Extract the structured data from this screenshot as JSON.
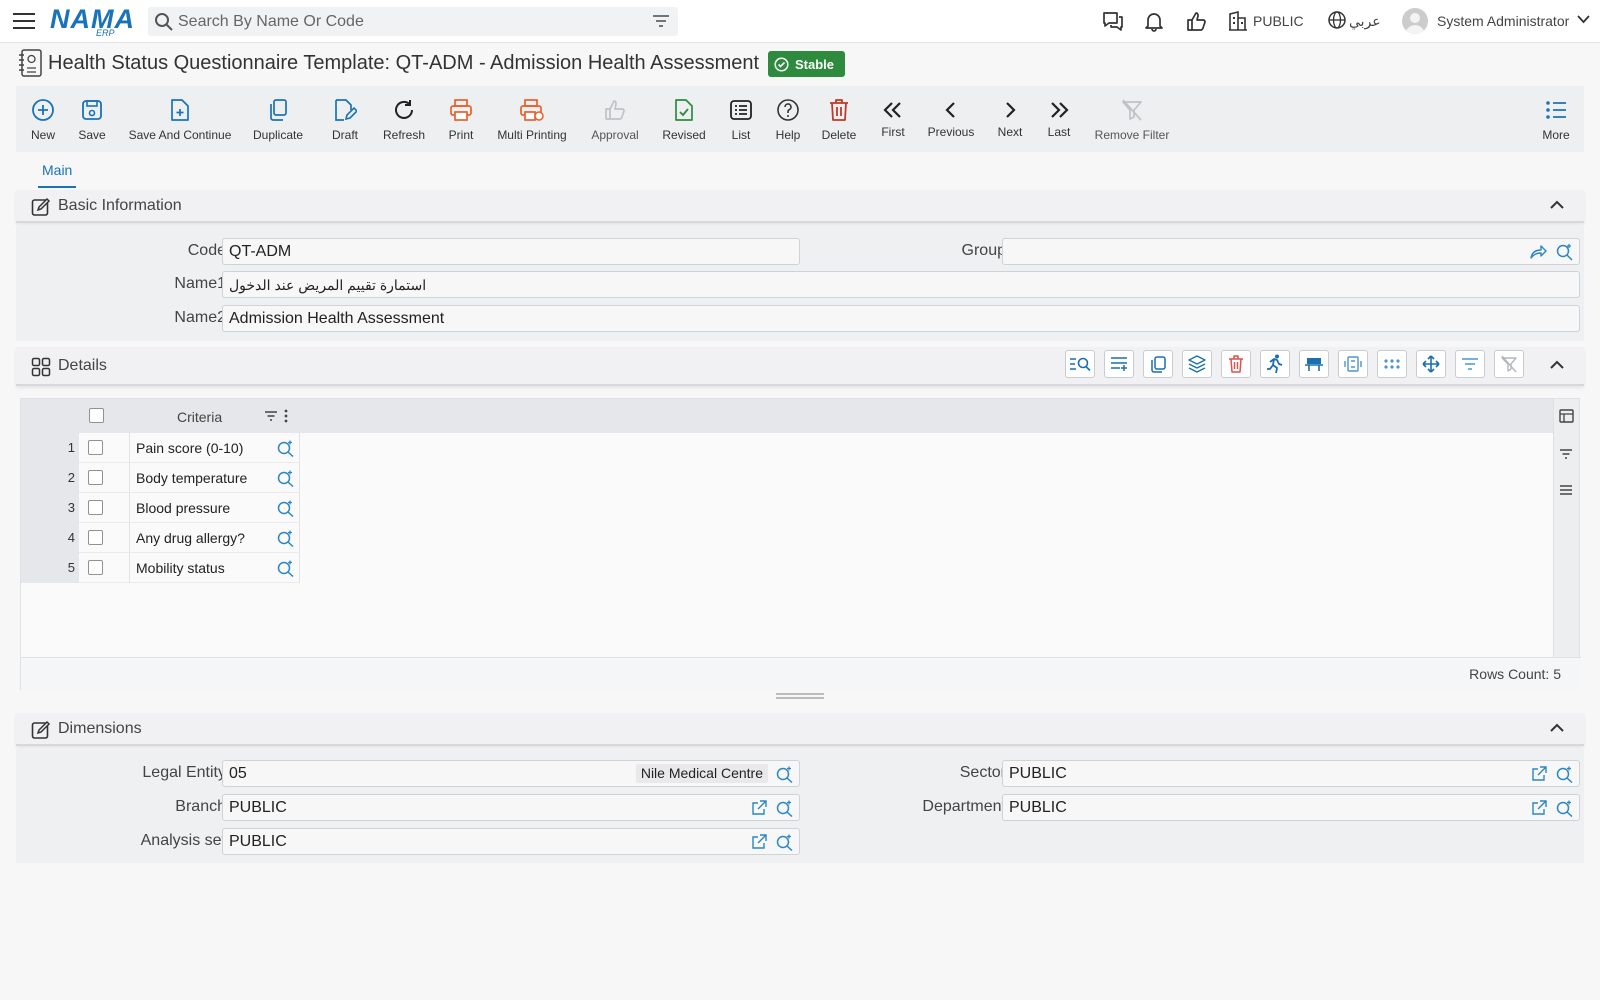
{
  "brand": {
    "logo_main": "NAMA",
    "logo_sub": "ERP"
  },
  "search": {
    "placeholder": "Search By Name Or Code"
  },
  "topbar": {
    "company": "PUBLIC",
    "language": "عربي",
    "user": "System Administrator"
  },
  "page": {
    "title": "Health Status Questionnaire Template: QT-ADM - Admission Health Assessment",
    "status": "Stable"
  },
  "toolbar": {
    "new": "New",
    "save": "Save",
    "save_continue": "Save And Continue",
    "duplicate": "Duplicate",
    "draft": "Draft",
    "refresh": "Refresh",
    "print": "Print",
    "multi_printing": "Multi Printing",
    "approval": "Approval",
    "revised": "Revised",
    "list": "List",
    "help": "Help",
    "delete": "Delete",
    "first": "First",
    "previous": "Previous",
    "next": "Next",
    "last": "Last",
    "remove_filter": "Remove Filter",
    "more": "More"
  },
  "tabs": {
    "main": "Main"
  },
  "basic": {
    "title": "Basic Information",
    "code_label": "Code",
    "code_value": "QT-ADM",
    "group_label": "Group",
    "group_value": "",
    "name1_label": "Name1",
    "name1_value": "استمارة تقييم المريض عند الدخول",
    "name2_label": "Name2",
    "name2_value": "Admission Health Assessment"
  },
  "details": {
    "title": "Details",
    "column_criteria": "Criteria",
    "rows": [
      {
        "num": "1",
        "criteria": "Pain score (0-10)"
      },
      {
        "num": "2",
        "criteria": "Body temperature"
      },
      {
        "num": "3",
        "criteria": "Blood pressure"
      },
      {
        "num": "4",
        "criteria": "Any drug allergy?"
      },
      {
        "num": "5",
        "criteria": "Mobility status"
      }
    ],
    "rows_count": "Rows Count: 5"
  },
  "dimensions": {
    "title": "Dimensions",
    "legal_entity_label": "Legal Entity",
    "legal_entity_value": "05",
    "legal_entity_name": "Nile Medical Centre",
    "sector_label": "Sector",
    "sector_value": "PUBLIC",
    "branch_label": "Branch",
    "branch_value": "PUBLIC",
    "department_label": "Department",
    "department_value": "PUBLIC",
    "analysis_label": "Analysis set",
    "analysis_value": "PUBLIC"
  },
  "colors": {
    "accent": "#1a73b8",
    "stable": "#2e8b3d",
    "print": "#e8622c",
    "delete": "#c0392b",
    "approve_green": "#2e8b3d"
  },
  "icons": [
    "menu-icon",
    "search-icon",
    "filter-icon",
    "chat-icon",
    "bell-icon",
    "thumbs-up-icon",
    "building-icon",
    "globe-icon",
    "user-icon",
    "chevron-down-icon"
  ]
}
